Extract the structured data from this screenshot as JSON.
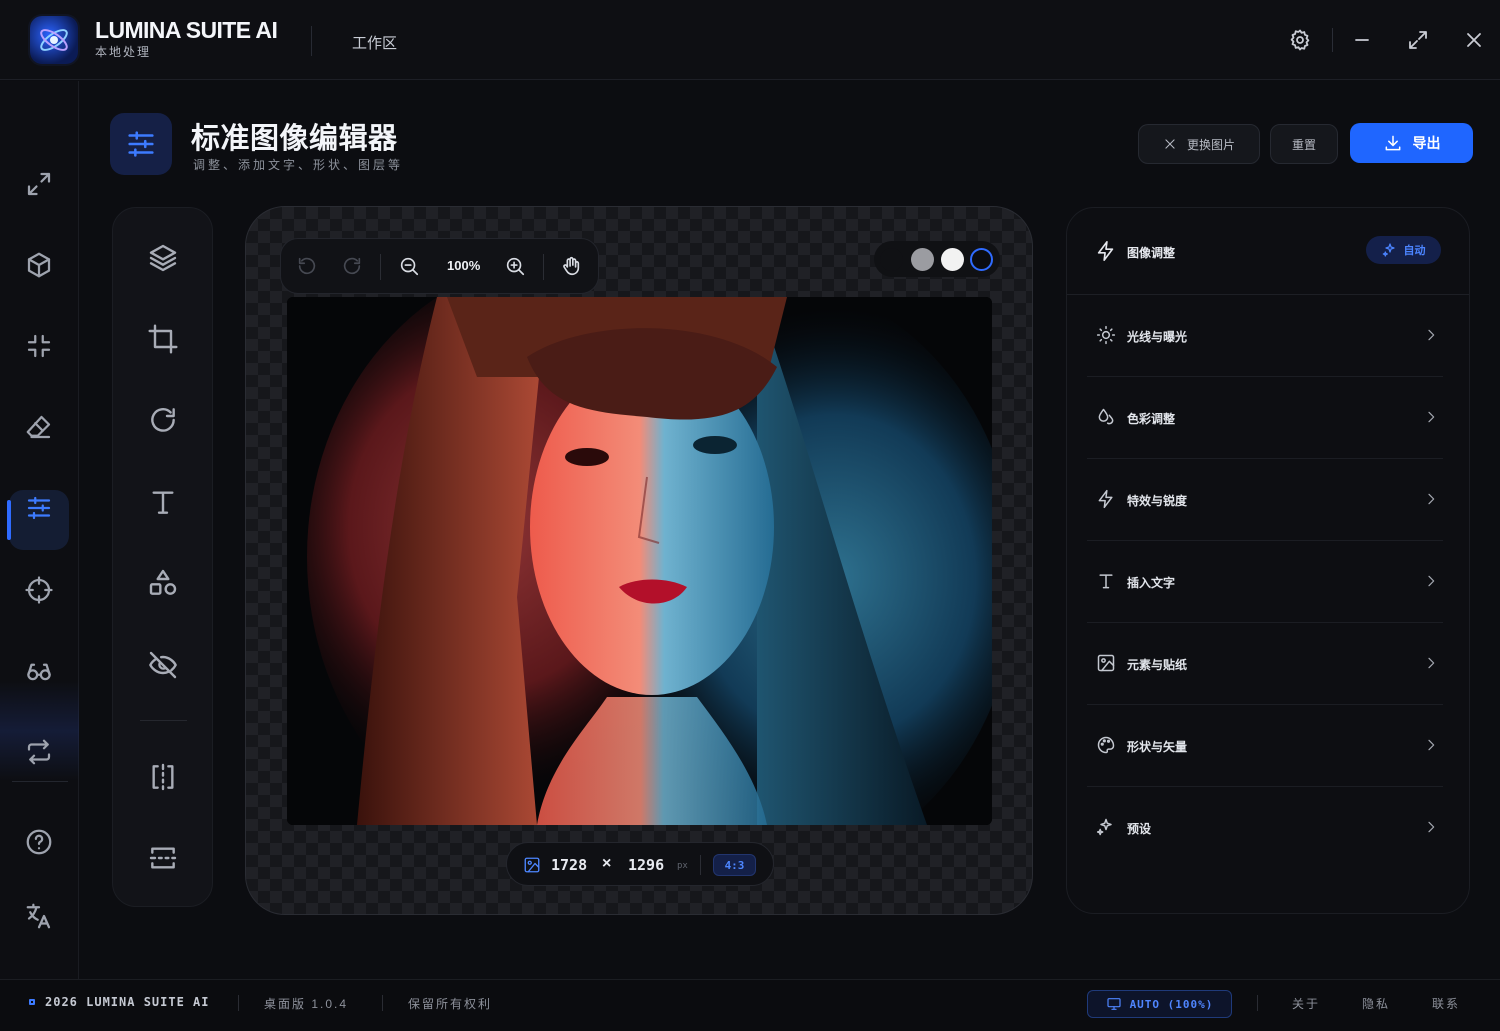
{
  "app": {
    "title": "LUMINA SUITE AI",
    "subtitle": "本地处理",
    "workspace_label": "工作区",
    "accent_color": "#1f66ff"
  },
  "window_controls": [
    "gear-icon",
    "minimize-icon",
    "expand-icon",
    "close-icon"
  ],
  "sidebar": {
    "items": [
      {
        "icon": "upscale-icon",
        "active": false
      },
      {
        "icon": "cube-icon",
        "active": false
      },
      {
        "icon": "compress-icon",
        "active": false
      },
      {
        "icon": "eraser-icon",
        "active": false
      },
      {
        "icon": "sliders-icon",
        "active": true
      },
      {
        "icon": "crosshair-icon",
        "active": false
      },
      {
        "icon": "glasses-icon",
        "active": false
      },
      {
        "icon": "convert-icon",
        "active": false
      },
      {
        "icon": "help-icon",
        "active": false
      },
      {
        "icon": "translate-icon",
        "active": false
      }
    ]
  },
  "header": {
    "title": "标准图像编辑器",
    "subtitle": "调整、添加文字、形状、图层等",
    "replace_label": "更换图片",
    "reset_label": "重置",
    "export_label": "导出"
  },
  "tools": [
    "layers-icon",
    "crop-icon",
    "rotate-icon",
    "text-icon",
    "shapes-icon",
    "hide-icon",
    "split-vertical-icon",
    "split-horizontal-icon"
  ],
  "canvas": {
    "zoom": "100%",
    "width": "1728",
    "height": "1296",
    "times": "×",
    "unit": "px",
    "ratio": "4:3",
    "background_swatches": [
      "#101114",
      "#9b9ca1",
      "#f2f2f2",
      "#0b0c10"
    ]
  },
  "panel": {
    "title": "图像调整",
    "auto_label": "自动",
    "rows": [
      {
        "label": "光线与曝光",
        "icon": "sun-icon"
      },
      {
        "label": "色彩调整",
        "icon": "color-drops-icon"
      },
      {
        "label": "特效与锐度",
        "icon": "bolt-icon"
      },
      {
        "label": "插入文字",
        "icon": "text-icon"
      },
      {
        "label": "元素与贴纸",
        "icon": "image-icon"
      },
      {
        "label": "形状与矢量",
        "icon": "palette-icon"
      },
      {
        "label": "预设",
        "icon": "sparkles-icon"
      }
    ]
  },
  "footer": {
    "copyright": "2026 LUMINA SUITE AI",
    "version": "桌面版 1.0.4",
    "rights": "保留所有权利",
    "status": "AUTO (100%)",
    "about": "关于",
    "privacy": "隐私",
    "contact": "联系"
  }
}
